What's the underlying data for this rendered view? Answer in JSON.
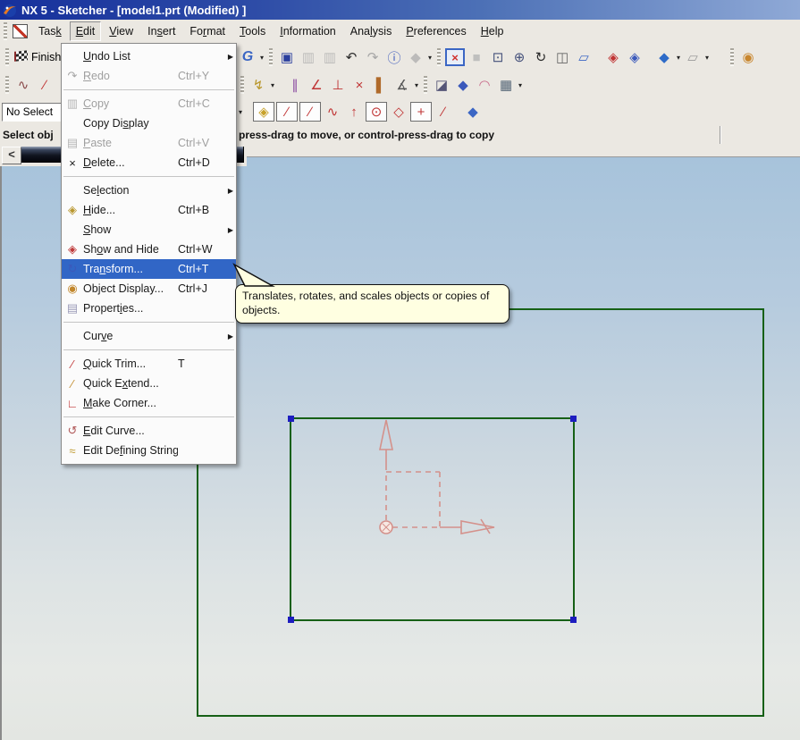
{
  "title_bar": {
    "title": "NX 5 - Sketcher - [model1.prt (Modified) ]"
  },
  "menu_bar": {
    "items": [
      {
        "label": "Task",
        "mn": 3
      },
      {
        "label": "Edit",
        "mn": 0,
        "pressed": true
      },
      {
        "label": "View",
        "mn": 0
      },
      {
        "label": "Insert",
        "mn": 2
      },
      {
        "label": "Format",
        "mn": 2
      },
      {
        "label": "Tools",
        "mn": 0
      },
      {
        "label": "Information",
        "mn": 0
      },
      {
        "label": "Analysis",
        "mn": 3
      },
      {
        "label": "Preferences",
        "mn": 0
      },
      {
        "label": "Help",
        "mn": 0
      }
    ]
  },
  "edit_menu": {
    "items": [
      {
        "label": "Undo List",
        "mn": 0,
        "submenu": true
      },
      {
        "label": "Redo",
        "mn": 0,
        "shortcut": "Ctrl+Y",
        "icon": "redo-icon",
        "glyph": "↷",
        "color": "#a6a6a6",
        "disabled": true
      },
      {
        "sep": true
      },
      {
        "label": "Copy",
        "mn": 0,
        "shortcut": "Ctrl+C",
        "icon": "copy-icon",
        "glyph": "▥",
        "color": "#b4b4b4",
        "disabled": true
      },
      {
        "label": "Copy Display",
        "mn": 7
      },
      {
        "label": "Paste",
        "mn": 0,
        "shortcut": "Ctrl+V",
        "icon": "paste-icon",
        "glyph": "▤",
        "color": "#b4b4b4",
        "disabled": true
      },
      {
        "label": "Delete...",
        "mn": 0,
        "shortcut": "Ctrl+D",
        "icon": "delete-icon",
        "glyph": "×",
        "color": "#1a1a1a"
      },
      {
        "sep": true
      },
      {
        "label": "Selection",
        "mn": 2,
        "submenu": true
      },
      {
        "label": "Hide...",
        "mn": 0,
        "shortcut": "Ctrl+B",
        "icon": "hide-icon",
        "glyph": "◈",
        "color": "#b9972f"
      },
      {
        "label": "Show",
        "mn": 0,
        "submenu": true
      },
      {
        "label": "Show and Hide",
        "mn": 2,
        "shortcut": "Ctrl+W",
        "icon": "show-and-hide-icon",
        "glyph": "◈",
        "color": "#bf3a3a"
      },
      {
        "label": "Transform...",
        "mn": 3,
        "shortcut": "Ctrl+T",
        "icon": "transform-icon",
        "glyph": "↻",
        "color": "#3b59bb",
        "highlighted": true
      },
      {
        "label": "Object Display...",
        "mn": 2,
        "shortcut": "Ctrl+J",
        "icon": "object-display-icon",
        "glyph": "◉",
        "color": "#c2872c"
      },
      {
        "label": "Properties...",
        "mn": 7,
        "icon": "properties-icon",
        "glyph": "▤",
        "color": "#9a9ab8"
      },
      {
        "sep": true
      },
      {
        "label": "Curve",
        "mn": 3,
        "submenu": true
      },
      {
        "sep": true
      },
      {
        "label": "Quick Trim...",
        "mn": 0,
        "shortcut": "T",
        "icon": "quick-trim-icon",
        "glyph": "∕",
        "color": "#c03434"
      },
      {
        "label": "Quick Extend...",
        "mn": 7,
        "icon": "quick-extend-icon",
        "glyph": "∕",
        "color": "#c08a2a"
      },
      {
        "label": "Make Corner...",
        "mn": 0,
        "icon": "make-corner-icon",
        "glyph": "∟",
        "color": "#c03434"
      },
      {
        "sep": true
      },
      {
        "label": "Edit Curve...",
        "mn": 0,
        "icon": "edit-curve-icon",
        "glyph": "↺",
        "color": "#b05858"
      },
      {
        "label": "Edit Defining String...",
        "mn": 7,
        "icon": "edit-defining-string-icon",
        "glyph": "≈",
        "color": "#bf9a30"
      }
    ]
  },
  "tooltip": {
    "text": "Translates, rotates, and scales objects or copies of objects."
  },
  "cue_bar": {
    "prompt": "Select obj",
    "message": "press-drag to move, or control-press-drag to copy"
  },
  "left_tools": {
    "back_label": "<",
    "finish_label": "Finish",
    "selection_filter": "No Select"
  },
  "toolbars": {
    "row1_left": [
      {
        "t": "g"
      },
      {
        "t": "f",
        "n": "finish-flag-icon"
      },
      {
        "t": "lbl",
        "n": "finish-sketch-button",
        "text": "Finish"
      }
    ],
    "row1_right": [
      {
        "t": "i",
        "n": "rotate-view-icon",
        "ch": "G",
        "col": "#3b66c4",
        "cls": "gbold"
      },
      {
        "t": "c"
      },
      {
        "t": "g"
      },
      {
        "t": "i",
        "n": "save-icon",
        "ch": "▣",
        "col": "#2b3f9e"
      },
      {
        "t": "i",
        "n": "copy-icon",
        "ch": "▥",
        "col": "#b4b4b4",
        "dis": 1
      },
      {
        "t": "i",
        "n": "paste-icon",
        "ch": "▥",
        "col": "#b4b4b4",
        "dis": 1
      },
      {
        "t": "i",
        "n": "undo-icon",
        "ch": "↶",
        "col": "#2a2a2a"
      },
      {
        "t": "i",
        "n": "redo-icon",
        "ch": "↷",
        "col": "#a6a6a6"
      },
      {
        "t": "i",
        "n": "edit-object-display-icon",
        "ch": "ⓘ",
        "col": "#3b59bb"
      },
      {
        "t": "i",
        "n": "snapshot-icon",
        "ch": "◆",
        "col": "#b4b4b4",
        "dis": 1
      },
      {
        "t": "c"
      },
      {
        "t": "g"
      },
      {
        "t": "i",
        "n": "fit-view-icon",
        "ch": "×",
        "col": "#d03030",
        "cls": "bluebox"
      },
      {
        "t": "i",
        "n": "zoom-disabled-icon",
        "ch": "■",
        "col": "#b8b8b8",
        "dis": 1
      },
      {
        "t": "i",
        "n": "zoom-box-icon",
        "ch": "⊡",
        "col": "#44507a"
      },
      {
        "t": "i",
        "n": "zoom-icon",
        "ch": "⊕",
        "col": "#44507a"
      },
      {
        "t": "i",
        "n": "rotate-icon",
        "ch": "↻",
        "col": "#2a2a2a"
      },
      {
        "t": "i",
        "n": "pan-icon",
        "ch": "◫",
        "col": "#666666"
      },
      {
        "t": "i",
        "n": "perspective-icon",
        "ch": "▱",
        "col": "#3b66c4"
      },
      {
        "t": "s"
      },
      {
        "t": "i",
        "n": "show-hide-icon",
        "ch": "◈",
        "col": "#c03434"
      },
      {
        "t": "i",
        "n": "invert-shown-icon",
        "ch": "◈",
        "col": "#3b59bb"
      },
      {
        "t": "s"
      },
      {
        "t": "i",
        "n": "shaded-display-icon",
        "ch": "◆",
        "col": "#2e6bc8"
      },
      {
        "t": "c"
      },
      {
        "t": "i",
        "n": "display-mode-icon",
        "ch": "▱",
        "col": "#9a9a9a"
      },
      {
        "t": "c"
      },
      {
        "t": "s"
      },
      {
        "t": "s"
      },
      {
        "t": "g"
      },
      {
        "t": "i",
        "n": "roles-icon",
        "ch": "◉",
        "col": "#c8862e"
      }
    ],
    "row2_left": [
      {
        "t": "g"
      },
      {
        "t": "i",
        "n": "profile-icon",
        "ch": "∿",
        "col": "#8a4a4a"
      },
      {
        "t": "i",
        "n": "line-icon",
        "ch": "∕",
        "col": "#c03434"
      },
      {
        "t": "i",
        "n": "arc-icon",
        "ch": "◠",
        "col": "#d08080"
      }
    ],
    "row2_right": [
      {
        "t": "g"
      },
      {
        "t": "i",
        "n": "create-constraint-icon",
        "ch": "↯",
        "col": "#b8962a"
      },
      {
        "t": "c"
      },
      {
        "t": "s"
      },
      {
        "t": "i",
        "n": "parallel-constraint-icon",
        "ch": "∥",
        "col": "#8a4aa0"
      },
      {
        "t": "i",
        "n": "auto-constrain-icon",
        "ch": "∠",
        "col": "#c03434"
      },
      {
        "t": "i",
        "n": "auto-dimension-icon",
        "ch": "⊥",
        "col": "#c03434"
      },
      {
        "t": "i",
        "n": "show-remove-constraints-icon",
        "ch": "×",
        "col": "#c03434"
      },
      {
        "t": "i",
        "n": "animate-dimension-icon",
        "ch": "▌",
        "col": "#b06a2a"
      },
      {
        "t": "i",
        "n": "convert-reference-icon",
        "ch": "∡",
        "col": "#555555"
      },
      {
        "t": "c"
      },
      {
        "t": "g"
      },
      {
        "t": "i",
        "n": "display-sketch-constraints-icon",
        "ch": "◪",
        "col": "#555577"
      },
      {
        "t": "i",
        "n": "orient-to-sketch-icon",
        "ch": "◆",
        "col": "#3b59bb"
      },
      {
        "t": "i",
        "n": "project-curve-icon",
        "ch": "◠",
        "col": "#c86a8a"
      },
      {
        "t": "i",
        "n": "alternate-solution-icon",
        "ch": "▦",
        "col": "#556677"
      },
      {
        "t": "c"
      }
    ],
    "row3_left": [
      {
        "t": "combo",
        "n": "selection-filter-combo",
        "text": "No Select"
      }
    ],
    "row3_right": [
      {
        "t": "c"
      },
      {
        "t": "s"
      },
      {
        "t": "i",
        "n": "snap-point-icon",
        "ch": "◈",
        "col": "#c8a22a",
        "box": 1
      },
      {
        "t": "i",
        "n": "end-point-icon",
        "ch": "∕",
        "col": "#c03434",
        "box": 1
      },
      {
        "t": "i",
        "n": "mid-point-icon",
        "ch": "∕",
        "col": "#c03434",
        "box": 1
      },
      {
        "t": "i",
        "n": "control-point-icon",
        "ch": "∿",
        "col": "#c03434"
      },
      {
        "t": "i",
        "n": "intersection-point-icon",
        "ch": "↑",
        "col": "#c03434"
      },
      {
        "t": "i",
        "n": "arc-center-icon",
        "ch": "⊙",
        "col": "#c03434",
        "box": 1
      },
      {
        "t": "i",
        "n": "quadrant-point-icon",
        "ch": "◇",
        "col": "#c03434"
      },
      {
        "t": "i",
        "n": "existing-point-icon",
        "ch": "+",
        "col": "#c03434",
        "box": 1
      },
      {
        "t": "i",
        "n": "point-on-curve-icon",
        "ch": "∕",
        "col": "#c03434"
      },
      {
        "t": "s"
      },
      {
        "t": "i",
        "n": "sketch-plane-icon",
        "ch": "◆",
        "col": "#3b66c4"
      }
    ]
  },
  "colors": {
    "menu_highlight": "#3166c6",
    "tooltip_bg": "#ffffe1",
    "sketch_green": "#166016",
    "handle_blue": "#1d1dbf",
    "axis_salmon": "#d4918b",
    "titlebar_left": "#16309c",
    "titlebar_right": "#8fa9d6",
    "canvas_top": "#a7c3db",
    "canvas_bottom": "#e3e6e2",
    "dark_bar": "#10141f"
  }
}
